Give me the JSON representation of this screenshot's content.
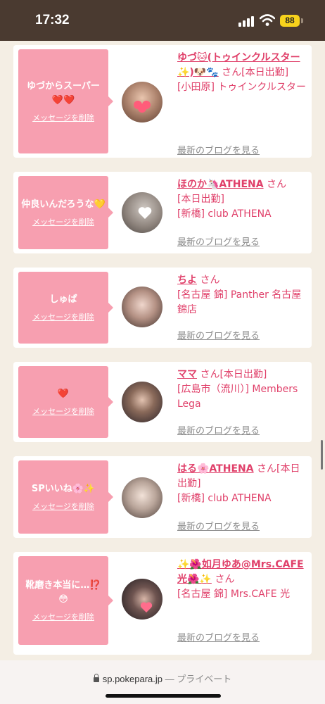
{
  "status_bar": {
    "time": "17:32",
    "battery": "88"
  },
  "cards": [
    {
      "message": "ゆづからスーパー❤️❤️",
      "delete_label": "メッセージを削除",
      "name": "ゆづ🐱(トゥインクルスター✨)🐶🐾",
      "san": "さん",
      "line1": "[本日出勤]",
      "line2": "[小田原] トゥインクルスター",
      "blog_label": "最新のブログを見る"
    },
    {
      "message": "仲良いんだろうな💛",
      "delete_label": "メッセージを削除",
      "name": "ほのか🦄ATHENA",
      "san": "さん",
      "line1": "[本日出勤]",
      "line2": "[新橋] club ATHENA",
      "blog_label": "最新のブログを見る"
    },
    {
      "message": "しゅぱ",
      "delete_label": "メッセージを削除",
      "name": "ちよ",
      "san": "さん",
      "line1": "",
      "line2": "[名古屋 錦] Panther 名古屋錦店",
      "blog_label": "最新のブログを見る"
    },
    {
      "message": "❤️",
      "delete_label": "メッセージを削除",
      "name": "ママ",
      "san": "さん",
      "line1": "[本日出勤]",
      "line2": "[広島市（流川）] Members Lega",
      "blog_label": "最新のブログを見る"
    },
    {
      "message": "SPいいね🌸✨",
      "delete_label": "メッセージを削除",
      "name": "はる🌸ATHENA",
      "san": "さん",
      "line1": "[本日出勤]",
      "line2": "[新橋] club ATHENA",
      "blog_label": "最新のブログを見る"
    },
    {
      "message": "靴磨き本当に…⁉️😳",
      "delete_label": "メッセージを削除",
      "name": "✨🌺如月ゆあ@Mrs.CAFE光🌺✨",
      "san": "さん",
      "line1": "",
      "line2": "[名古屋 錦] Mrs.CAFE 光",
      "blog_label": "最新のブログを見る"
    }
  ],
  "browser": {
    "domain": "sp.pokepara.jp",
    "separator": " — ",
    "private_label": "プライベート"
  }
}
